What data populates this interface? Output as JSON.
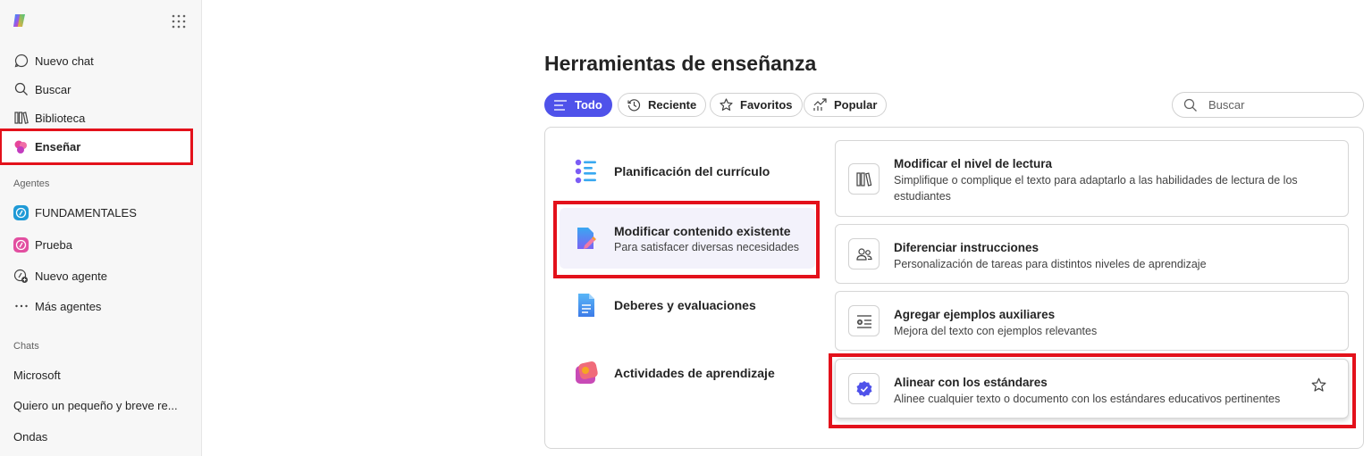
{
  "sidebar": {
    "nav": [
      {
        "label": "Nuevo chat",
        "icon": "chat-icon"
      },
      {
        "label": "Buscar",
        "icon": "search-icon"
      },
      {
        "label": "Biblioteca",
        "icon": "library-icon"
      },
      {
        "label": "Enseñar",
        "icon": "teach-icon"
      }
    ],
    "agents_label": "Agentes",
    "agents": [
      {
        "label": "FUNDAMENTALES",
        "icon": "agent-fundamentales-icon"
      },
      {
        "label": "Prueba",
        "icon": "agent-prueba-icon"
      },
      {
        "label": "Nuevo agente",
        "icon": "new-agent-icon"
      },
      {
        "label": "Más agentes",
        "icon": "more-icon"
      }
    ],
    "chats_label": "Chats",
    "chats": [
      "Microsoft",
      "Quiero un pequeño y breve re...",
      "Ondas"
    ]
  },
  "main": {
    "title": "Herramientas de enseñanza",
    "filters": [
      {
        "label": "Todo",
        "icon": "list-icon",
        "active": true
      },
      {
        "label": "Reciente",
        "icon": "history-icon",
        "active": false
      },
      {
        "label": "Favoritos",
        "icon": "star-icon",
        "active": false
      },
      {
        "label": "Popular",
        "icon": "trending-icon",
        "active": false
      }
    ],
    "search_placeholder": "Buscar",
    "categories": [
      {
        "title": "Planificación del currículo",
        "subtitle": "",
        "icon": "curriculum-icon"
      },
      {
        "title": "Modificar contenido existente",
        "subtitle": "Para satisfacer diversas necesidades",
        "icon": "modify-content-icon",
        "selected": true
      },
      {
        "title": "Deberes y evaluaciones",
        "subtitle": "",
        "icon": "document-icon"
      },
      {
        "title": "Actividades de aprendizaje",
        "subtitle": "",
        "icon": "activities-icon"
      }
    ],
    "tools": [
      {
        "title": "Modificar el nivel de lectura",
        "description": "Simplifique o complique el texto para adaptarlo a las habilidades de lectura de los estudiantes",
        "icon": "books-icon"
      },
      {
        "title": "Diferenciar instrucciones",
        "description": "Personalización de tareas para distintos niveles de aprendizaje",
        "icon": "people-icon"
      },
      {
        "title": "Agregar ejemplos auxiliares",
        "description": "Mejora del texto con ejemplos relevantes",
        "icon": "text-add-icon"
      },
      {
        "title": "Alinear con los estándares",
        "description": "Alinee cualquier texto o documento con los estándares educativos pertinentes",
        "icon": "verified-badge-icon",
        "favorite_icon": "star-outline-icon"
      }
    ]
  },
  "colors": {
    "accent": "#4f52ea",
    "highlight_red": "#e3111b",
    "sidebar_bg": "#f7f7f7"
  }
}
